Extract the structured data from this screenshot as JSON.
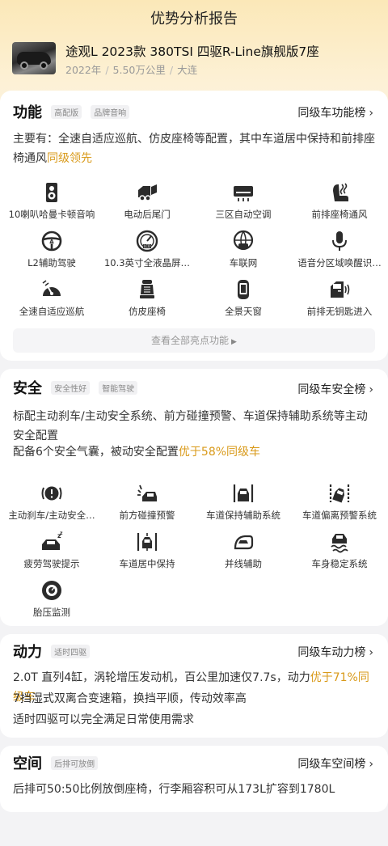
{
  "header": {
    "title": "优势分析报告"
  },
  "car": {
    "name": "途观L 2023款 380TSI 四驱R-Line旗舰版7座",
    "year": "2022年",
    "mileage": "5.50万公里",
    "city": "大连",
    "separator": "/"
  },
  "function_section": {
    "title": "功能",
    "tags": [
      "高配版",
      "品牌音响"
    ],
    "rank_link": "同级车功能榜",
    "desc_prefix": "主要有：全速自适应巡航、仿皮座椅等配置，其中车道居中保持和前排座椅通风",
    "desc_highlight": "同级领先",
    "features": [
      {
        "label": "10喇叭哈曼卡顿音响",
        "icon": "speaker-icon"
      },
      {
        "label": "电动后尾门",
        "icon": "power-tailgate-icon"
      },
      {
        "label": "三区自动空调",
        "icon": "air-conditioner-icon"
      },
      {
        "label": "前排座椅通风",
        "icon": "seat-ventilation-icon"
      },
      {
        "label": "L2辅助驾驶",
        "icon": "assisted-driving-icon"
      },
      {
        "label": "10.3英寸全液晶屏…",
        "icon": "lcd-dashboard-icon"
      },
      {
        "label": "车联网",
        "icon": "connected-car-icon"
      },
      {
        "label": "语音分区域唤醒识…",
        "icon": "microphone-icon"
      },
      {
        "label": "全速自适应巡航",
        "icon": "cruise-control-icon"
      },
      {
        "label": "仿皮座椅",
        "icon": "leather-seat-icon"
      },
      {
        "label": "全景天窗",
        "icon": "panoramic-sunroof-icon"
      },
      {
        "label": "前排无钥匙进入",
        "icon": "keyless-entry-icon"
      }
    ],
    "view_all": "查看全部亮点功能"
  },
  "safety_section": {
    "title": "安全",
    "tags": [
      "安全性好",
      "智能驾驶"
    ],
    "rank_link": "同级车安全榜",
    "desc1": "标配主动刹车/主动安全系统、前方碰撞预警、车道保持辅助系统等主动安全配置",
    "desc2_prefix": "配备6个安全气囊，被动安全配置",
    "desc2_highlight": "优于58%同级车",
    "features": [
      {
        "label": "主动刹车/主动安全…",
        "icon": "active-brake-icon"
      },
      {
        "label": "前方碰撞预警",
        "icon": "collision-warning-icon"
      },
      {
        "label": "车道保持辅助系统",
        "icon": "lane-keep-icon"
      },
      {
        "label": "车道偏离预警系统",
        "icon": "lane-departure-icon"
      },
      {
        "label": "疲劳驾驶提示",
        "icon": "fatigue-alert-icon"
      },
      {
        "label": "车道居中保持",
        "icon": "lane-center-icon"
      },
      {
        "label": "并线辅助",
        "icon": "blind-spot-icon"
      },
      {
        "label": "车身稳定系统",
        "icon": "stability-control-icon"
      },
      {
        "label": "胎压监测",
        "icon": "tire-pressure-icon"
      }
    ]
  },
  "power_section": {
    "title": "动力",
    "tags": [
      "适时四驱"
    ],
    "rank_link": "同级车动力榜",
    "line1_prefix": "2.0T 直列4缸，涡轮增压发动机，百公里加速仅7.7s，动力",
    "line1_highlight": "优于71%同级车",
    "line2": "7挡湿式双离合变速箱，换挡平顺，传动效率高",
    "line3": "适时四驱可以完全满足日常使用需求"
  },
  "space_section": {
    "title": "空间",
    "tags": [
      "后排可放倒"
    ],
    "rank_link": "同级车空间榜",
    "line1": "后排可50:50比例放倒座椅，行李厢容积可从173L扩容到1780L"
  },
  "colors": {
    "accent": "#d99a1a",
    "header_gradient_top": "#fbe8b8",
    "icon": "#2b2b2b"
  }
}
